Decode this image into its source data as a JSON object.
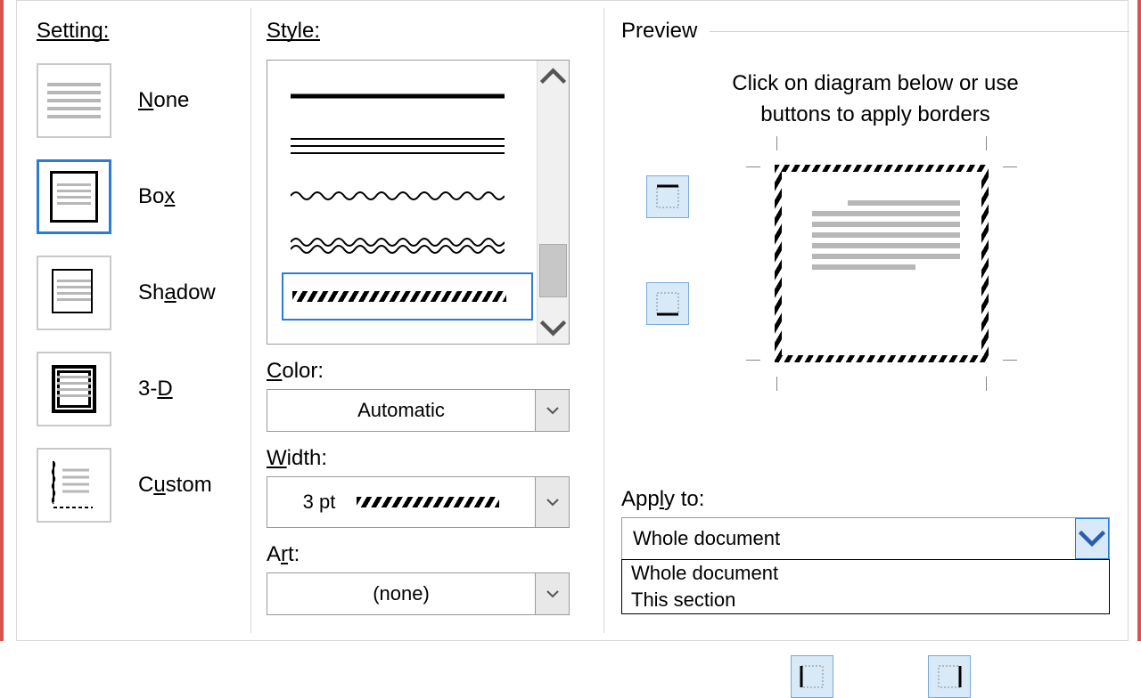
{
  "setting": {
    "label": "Setting:",
    "items": [
      {
        "id": "none",
        "label_pre": "",
        "mn": "N",
        "label_post": "one"
      },
      {
        "id": "box",
        "label_pre": "Bo",
        "mn": "x",
        "label_post": ""
      },
      {
        "id": "shadow",
        "label_pre": "Sh",
        "mn": "a",
        "label_post": "dow"
      },
      {
        "id": "three-d",
        "label_pre": "3-",
        "mn": "D",
        "label_post": ""
      },
      {
        "id": "custom",
        "label_pre": "C",
        "mn": "u",
        "label_post": "stom"
      }
    ],
    "selected": "box"
  },
  "style": {
    "label": "Style:",
    "options": [
      "solid-thick",
      "triple-thin",
      "wavy",
      "double-wavy",
      "diagonal-hatch"
    ],
    "selected": "diagonal-hatch"
  },
  "color": {
    "label_pre": "",
    "mn": "C",
    "label_post": "olor:",
    "value": "Automatic"
  },
  "width": {
    "label_pre": "",
    "mn": "W",
    "label_post": "idth:",
    "value": "3 pt"
  },
  "art": {
    "label_pre": "A",
    "mn": "r",
    "label_post": "t:",
    "value": "(none)"
  },
  "preview": {
    "heading": "Preview",
    "caption_l1": "Click on diagram below or use",
    "caption_l2": "buttons to apply borders"
  },
  "apply_to": {
    "label_pre": "App",
    "mn": "l",
    "label_post": "y to:",
    "value": "Whole document",
    "options": [
      "Whole document",
      "This section"
    ]
  }
}
